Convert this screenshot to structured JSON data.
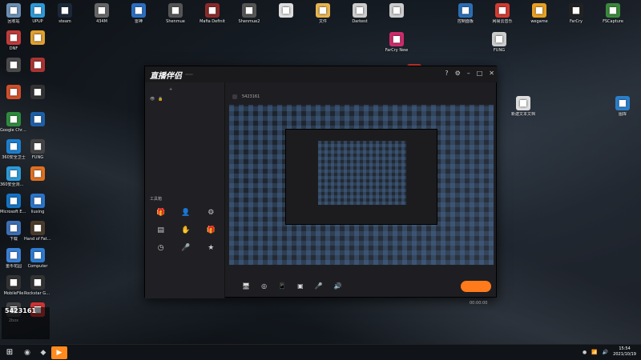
{
  "desktop_icons_col1": [
    {
      "label": "回收站",
      "icon": "recycle-bin-icon",
      "color": "#6c8fb5"
    },
    {
      "label": "DNF",
      "icon": "app-icon",
      "color": "#c13b3b"
    },
    {
      "label": "",
      "icon": "app-icon",
      "color": "#4a4a4a"
    },
    {
      "label": "",
      "icon": "app-icon",
      "color": "#d04f2a"
    },
    {
      "label": "Google Chrome",
      "icon": "chrome-icon",
      "color": "#2e8b3d"
    },
    {
      "label": "360安全卫士",
      "icon": "shield-icon",
      "color": "#1b7fd1"
    },
    {
      "label": "360安全浏览器",
      "icon": "browser-icon",
      "color": "#2d9ad8"
    },
    {
      "label": "Microsoft Edge",
      "icon": "edge-icon",
      "color": "#1573c4"
    },
    {
      "label": "下载",
      "icon": "download-icon",
      "color": "#3c6fb5"
    },
    {
      "label": "金币花园",
      "icon": "app-icon",
      "color": "#3a80d6"
    },
    {
      "label": "MobileFile",
      "icon": "app-icon",
      "color": "#333"
    },
    {
      "label": "2box",
      "icon": "app-icon",
      "color": "#444"
    }
  ],
  "desktop_icons_col2": [
    {
      "label": "UPUP",
      "icon": "app-icon",
      "color": "#2d9ad8"
    },
    {
      "label": "",
      "icon": "app-icon",
      "color": "#e0a030"
    },
    {
      "label": "",
      "icon": "app-icon",
      "color": "#aa3333"
    },
    {
      "label": "",
      "icon": "app-icon",
      "color": "#333"
    },
    {
      "label": "",
      "icon": "app-icon",
      "color": "#1e5fa8"
    },
    {
      "label": "FUNG",
      "icon": "app-icon",
      "color": "#444"
    },
    {
      "label": "",
      "icon": "app-icon",
      "color": "#e07020"
    },
    {
      "label": "liuxing",
      "icon": "app-icon",
      "color": "#2b74c9"
    },
    {
      "label": "Hand of Fate 2",
      "icon": "app-icon",
      "color": "#4b3b2b"
    },
    {
      "label": "Computer",
      "icon": "computer-icon",
      "color": "#2d7bd1"
    },
    {
      "label": "Rockstar Games",
      "icon": "app-icon",
      "color": "#333"
    },
    {
      "label": "",
      "icon": "app-icon",
      "color": "#cc3333"
    }
  ],
  "desktop_icons_top": [
    {
      "label": "steam",
      "icon": "steam-icon",
      "color": "#1b2838"
    },
    {
      "label": "434M",
      "icon": "app-icon",
      "color": "#666"
    },
    {
      "label": "雷神",
      "icon": "app-icon",
      "color": "#2b6ec1"
    },
    {
      "label": "Shenmue",
      "icon": "app-icon",
      "color": "#555"
    },
    {
      "label": "Mafia Definit",
      "icon": "app-icon",
      "color": "#8a2a2a"
    },
    {
      "label": "Shenmue2",
      "icon": "app-icon",
      "color": "#555"
    },
    {
      "label": "",
      "icon": "file-icon",
      "color": "#ddd"
    },
    {
      "label": "文件",
      "icon": "folder-icon",
      "color": "#e6b450"
    },
    {
      "label": "Darkest",
      "icon": "file-icon",
      "color": "#ccc"
    },
    {
      "label": "",
      "icon": "file-icon",
      "color": "#ccc"
    },
    {
      "label": "控制面板",
      "icon": "control-panel-icon",
      "color": "#2c6eb5"
    },
    {
      "label": "网易云音乐",
      "icon": "music-icon",
      "color": "#d33a31"
    },
    {
      "label": "wegame",
      "icon": "app-icon",
      "color": "#e8a020"
    },
    {
      "label": "FarCry",
      "icon": "app-icon",
      "color": "#222"
    },
    {
      "label": "FSCapture",
      "icon": "app-icon",
      "color": "#3a8a3a"
    }
  ],
  "desktop_icons_right": [
    {
      "label": "FarCry New",
      "icon": "app-icon",
      "color": "#cc2b6b"
    },
    {
      "label": "",
      "icon": "app-icon",
      "color": "#d33a31"
    },
    {
      "label": "FUNG",
      "icon": "file-icon",
      "color": "#ccc"
    },
    {
      "label": "新建文本文档",
      "icon": "file-icon",
      "color": "#ddd"
    },
    {
      "label": "图库",
      "icon": "app-icon",
      "color": "#2b7fc9"
    }
  ],
  "app": {
    "logo": "直播伴侣",
    "version_badge": "",
    "left_tabs": [
      "",
      "",
      "",
      ""
    ],
    "scene_label": "",
    "toolbox_label": "工具箱",
    "tools": [
      {
        "label": "",
        "icon": "gift-icon"
      },
      {
        "label": "",
        "icon": "user-icon"
      },
      {
        "label": "",
        "icon": "settings-icon"
      },
      {
        "label": "",
        "icon": "chart-icon"
      },
      {
        "label": "",
        "icon": "hand-icon"
      },
      {
        "label": "",
        "icon": "gift-icon"
      },
      {
        "label": "",
        "icon": "clock-icon"
      },
      {
        "label": "",
        "icon": "mic-icon"
      },
      {
        "label": "",
        "icon": "star-icon"
      }
    ],
    "notice_text": "",
    "stream_title": "",
    "stream_id": "5423161",
    "edit_label": "",
    "category_label": "",
    "bottom_tools": [
      {
        "label": "",
        "icon": "screen-icon"
      },
      {
        "label": "",
        "icon": "camera-icon"
      },
      {
        "label": "",
        "icon": "phone-icon"
      },
      {
        "label": "",
        "icon": "window-icon"
      },
      {
        "label": "",
        "icon": "mic-icon"
      },
      {
        "label": "",
        "icon": "speaker-icon"
      }
    ],
    "go_live_label": "",
    "timer": "00:00:00"
  },
  "overlay": {
    "logo_text": "",
    "number": "5423161"
  },
  "taskbar": {
    "time": "15:54",
    "date": "2021/10/19"
  }
}
